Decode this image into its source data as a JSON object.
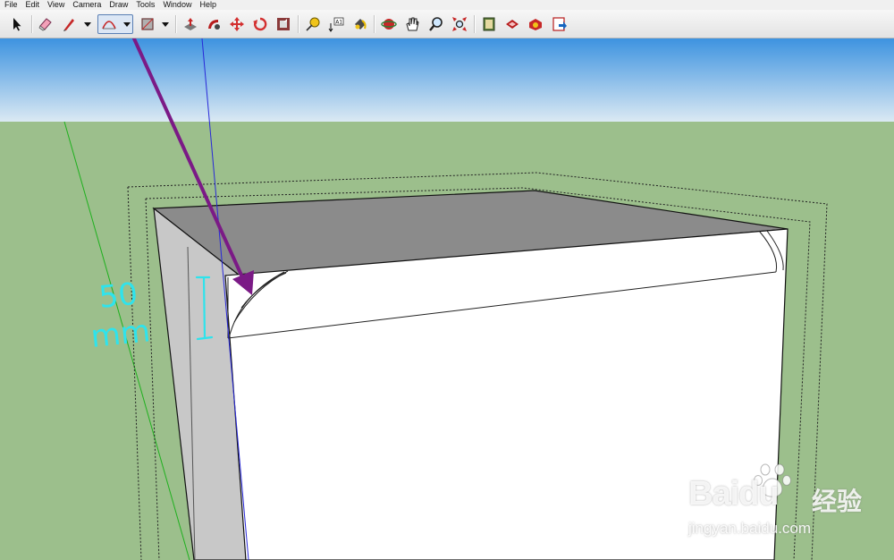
{
  "menu": [
    "File",
    "Edit",
    "View",
    "Camera",
    "Draw",
    "Tools",
    "Window",
    "Help"
  ],
  "toolbar": {
    "tools": [
      "select-icon",
      "eraser-icon",
      "pencil-icon",
      "arc-icon",
      "rectangle-icon",
      "push-pull-icon",
      "follow-me-icon",
      "move-icon",
      "rotate-icon",
      "offset-icon",
      "tape-measure-icon",
      "text-icon",
      "paint-bucket-icon",
      "orbit-icon",
      "pan-icon",
      "zoom-icon",
      "zoom-extents-icon",
      "get-models-icon",
      "share-model-icon",
      "components-icon",
      "export-icon"
    ],
    "active_tool": "arc-icon"
  },
  "annotation": {
    "text_line1": "50",
    "text_line2": "mm",
    "color": "#2fe3ec",
    "arrow_color": "#7b1a86"
  },
  "watermark": {
    "brand": "Baidu",
    "brand_cn": "经验",
    "url": "jingyan.baidu.com"
  },
  "colors": {
    "sky_top": "#3d93e0",
    "sky_bottom": "#dbe9f3",
    "ground": "#9cbf8c",
    "box_top": "#8b8b8b",
    "box_side": "#c8c8c8",
    "box_front": "#ffffff"
  }
}
